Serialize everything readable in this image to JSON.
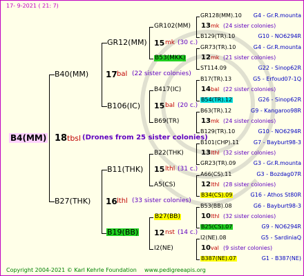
{
  "header": {
    "date": "17-  9-2021 (  21:  7)"
  },
  "footer": {
    "copyright": "Copyright 2004-2021 © Karl Kehrle Foundation",
    "site": "www.pedigreeapis.org"
  },
  "colors": {
    "cyan": "#00e0e0",
    "green": "#20d020",
    "yellow": "#ffff00",
    "lines": "#000000",
    "frame": "#c000c0"
  },
  "root": {
    "name": "B4(MM)",
    "count": "18",
    "code": "tbsl",
    "note": "Drones from 25 sister colonies"
  },
  "gen1": [
    {
      "name": "B40(MM)",
      "count": "17",
      "code": "bal",
      "note": "(22 sister colonies)"
    },
    {
      "name": "B27(THK)",
      "count": "16",
      "code": "lthl",
      "note": "(33 sister colonies)"
    }
  ],
  "gen2": [
    {
      "name": "GR12(MM)"
    },
    {
      "name": "B106(IC)",
      "count": "15",
      "code": "bal",
      "note": "(20 c.)"
    },
    {
      "name": "B11(THK)",
      "count": "15",
      "code": "lthl",
      "note": "(31 c.)"
    },
    {
      "name": "B19(BB)",
      "count": "12",
      "code": "nst",
      "note": "(14 c.)"
    }
  ],
  "gen3": [
    {
      "name": "GR102(MM)",
      "count": "15",
      "code": "mk",
      "note": "(30 c.)"
    },
    {
      "name": "B53(MKK)"
    },
    {
      "name": "B417(IC)"
    },
    {
      "name": "B69(TR)"
    },
    {
      "name": "B22(THK)"
    },
    {
      "name": "A5(CS)"
    },
    {
      "name": "B27(BB)"
    },
    {
      "name": "I2(NE)"
    }
  ],
  "gen4": [
    {
      "name": "GR128(MM).10",
      "right": "G4 - Gr.R.mounta"
    },
    {
      "count": "13",
      "code": "mk",
      "note": "(24 sister colonies)"
    },
    {
      "name": "B129(TR).10",
      "right": "G10 - NO6294R"
    },
    {
      "name": "GR73(TR).10",
      "right": "G4 - Gr.R.mounta"
    },
    {
      "count": "12",
      "code": "mk",
      "note": "(21 sister colonies)"
    },
    {
      "name": "ST114.09",
      "right": "G22 - Sinop62R"
    },
    {
      "name": "B17(TR).13",
      "right": "G5 - Erfoud07-1Q"
    },
    {
      "count": "14",
      "code": "bal",
      "note": "(22 sister colonies)"
    },
    {
      "name": "B54(TR).12",
      "right": "G26 - Sinop62R"
    },
    {
      "name": "B63(TR).12",
      "right": "G9 - Kangaroo98R"
    },
    {
      "count": "13",
      "code": "mk",
      "note": "(24 sister colonies)"
    },
    {
      "name": "B129(TR).10",
      "right": "G10 - NO6294R"
    },
    {
      "name": "B101(CHP).11",
      "right": "G7 - Bayburt98-3"
    },
    {
      "count": "13",
      "code": "lthl",
      "note": "(32 sister colonies)"
    },
    {
      "name": "GR23(TR).09",
      "right": "G3 - Gr.R.mounta"
    },
    {
      "name": "A66(CS).11",
      "right": "G3 - Bozdag07R"
    },
    {
      "count": "12",
      "code": "lthl",
      "note": "(28 sister colonies)"
    },
    {
      "name": "B34(CS).09",
      "right": "G16 - Athos St80R"
    },
    {
      "name": "B53(BB).08",
      "right": "G6 - Bayburt98-3"
    },
    {
      "count": "10",
      "code": "lthl",
      "note": "(32 sister colonies)"
    },
    {
      "name": "B25(CS).07",
      "right": "G9 - NO6294R"
    },
    {
      "name": "I2(NE).08",
      "right": "G5 - SardiniaQ"
    },
    {
      "count": "10",
      "code": "val",
      "note": "(9 sister colonies)"
    },
    {
      "name": "B387(NE).07",
      "right": "G1 - B387(NE)"
    }
  ]
}
